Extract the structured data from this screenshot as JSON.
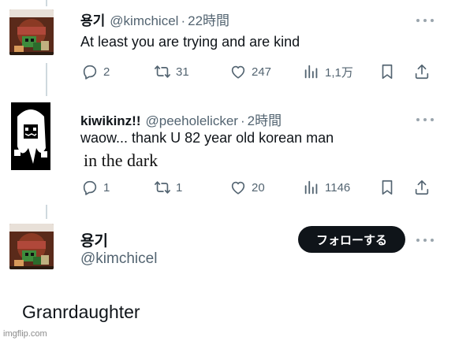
{
  "tweet1": {
    "display_name": "용기",
    "handle": "@kimchicel",
    "separator": "·",
    "time": "22時間",
    "text": "At least you are trying and are kind",
    "actions": {
      "replies": "2",
      "reposts": "31",
      "likes": "247",
      "views": "1,1万"
    }
  },
  "tweet2": {
    "display_name": "kiwikinz!!",
    "handle": "@peeholelicker",
    "separator": "·",
    "time": "2時間",
    "text": "waow... thank U 82 year old korean man",
    "caption": "in the dark",
    "actions": {
      "replies": "1",
      "reposts": "1",
      "likes": "20",
      "views": "1146"
    }
  },
  "profile": {
    "display_name": "용기",
    "handle": "@kimchicel",
    "follow_label": "フォローする"
  },
  "main_text": "Granrdaughter",
  "watermark": "imgflip.com",
  "icons": {
    "reply": "reply-icon",
    "repost": "repost-icon",
    "like": "heart-icon",
    "views": "views-icon",
    "bookmark": "bookmark-icon",
    "share": "share-icon",
    "more": "more-icon"
  },
  "colors": {
    "text": "#0f1419",
    "muted": "#536471",
    "button": "#0f1419",
    "thread_line": "#cfd9de"
  }
}
